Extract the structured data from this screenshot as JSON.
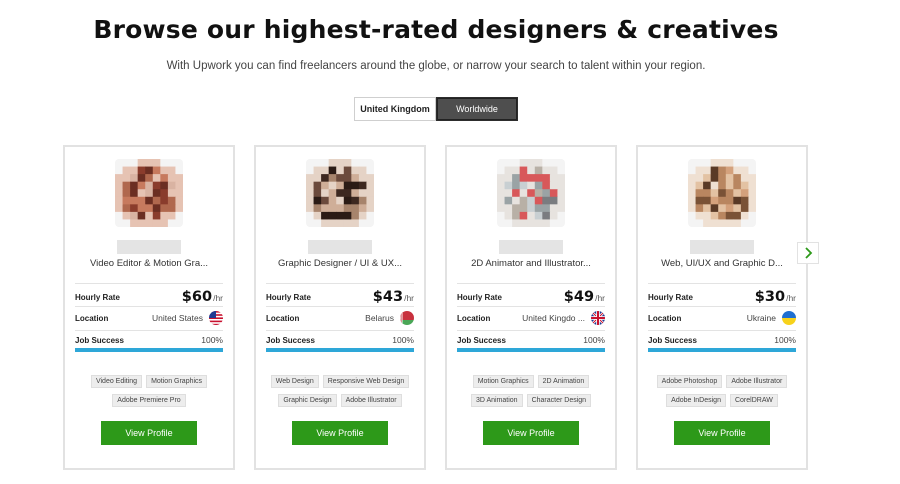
{
  "header": {
    "title": "Browse our highest-rated designers & creatives",
    "subtitle": "With Upwork you can find freelancers around the globe, or narrow your search to talent within your region."
  },
  "region_toggle": {
    "options": [
      "United Kingdom",
      "Worldwide"
    ],
    "selected": "Worldwide"
  },
  "labels": {
    "hourly_rate": "Hourly Rate",
    "location": "Location",
    "job_success": "Job Success",
    "rate_unit": "/hr",
    "view_profile": "View Profile"
  },
  "cards": [
    {
      "title": "Video Editor & Motion Gra...",
      "rate": "$60",
      "location": "United States",
      "flag": "us-flag-icon",
      "job_success": "100%",
      "job_success_fraction": 1.0,
      "skills": [
        "Video Editing",
        "Motion Graphics",
        "Adobe Premiere Pro"
      ]
    },
    {
      "title": "Graphic Designer / UI & UX...",
      "rate": "$43",
      "location": "Belarus",
      "flag": "belarus-flag-icon",
      "job_success": "100%",
      "job_success_fraction": 1.0,
      "skills": [
        "Web Design",
        "Responsive Web Design",
        "Graphic Design",
        "Adobe Illustrator"
      ]
    },
    {
      "title": "2D Animator and Illustrator...",
      "rate": "$49",
      "location": "United Kingdo ...",
      "flag": "uk-flag-icon",
      "job_success": "100%",
      "job_success_fraction": 1.0,
      "skills": [
        "Motion Graphics",
        "2D Animation",
        "3D Animation",
        "Character Design"
      ]
    },
    {
      "title": "Web, UI/UX and Graphic D...",
      "rate": "$30",
      "location": "Ukraine",
      "flag": "ukraine-flag-icon",
      "job_success": "100%",
      "job_success_fraction": 1.0,
      "skills": [
        "Adobe Photoshop",
        "Adobe Illustrator",
        "Adobe InDesign",
        "CorelDRAW"
      ]
    }
  ],
  "carousel": {
    "next_icon": "chevron-right-icon"
  },
  "colors": {
    "accent_green": "#2d9919",
    "job_success_bar": "#2ea7d8",
    "toggle_active": "#4e4e4e"
  }
}
